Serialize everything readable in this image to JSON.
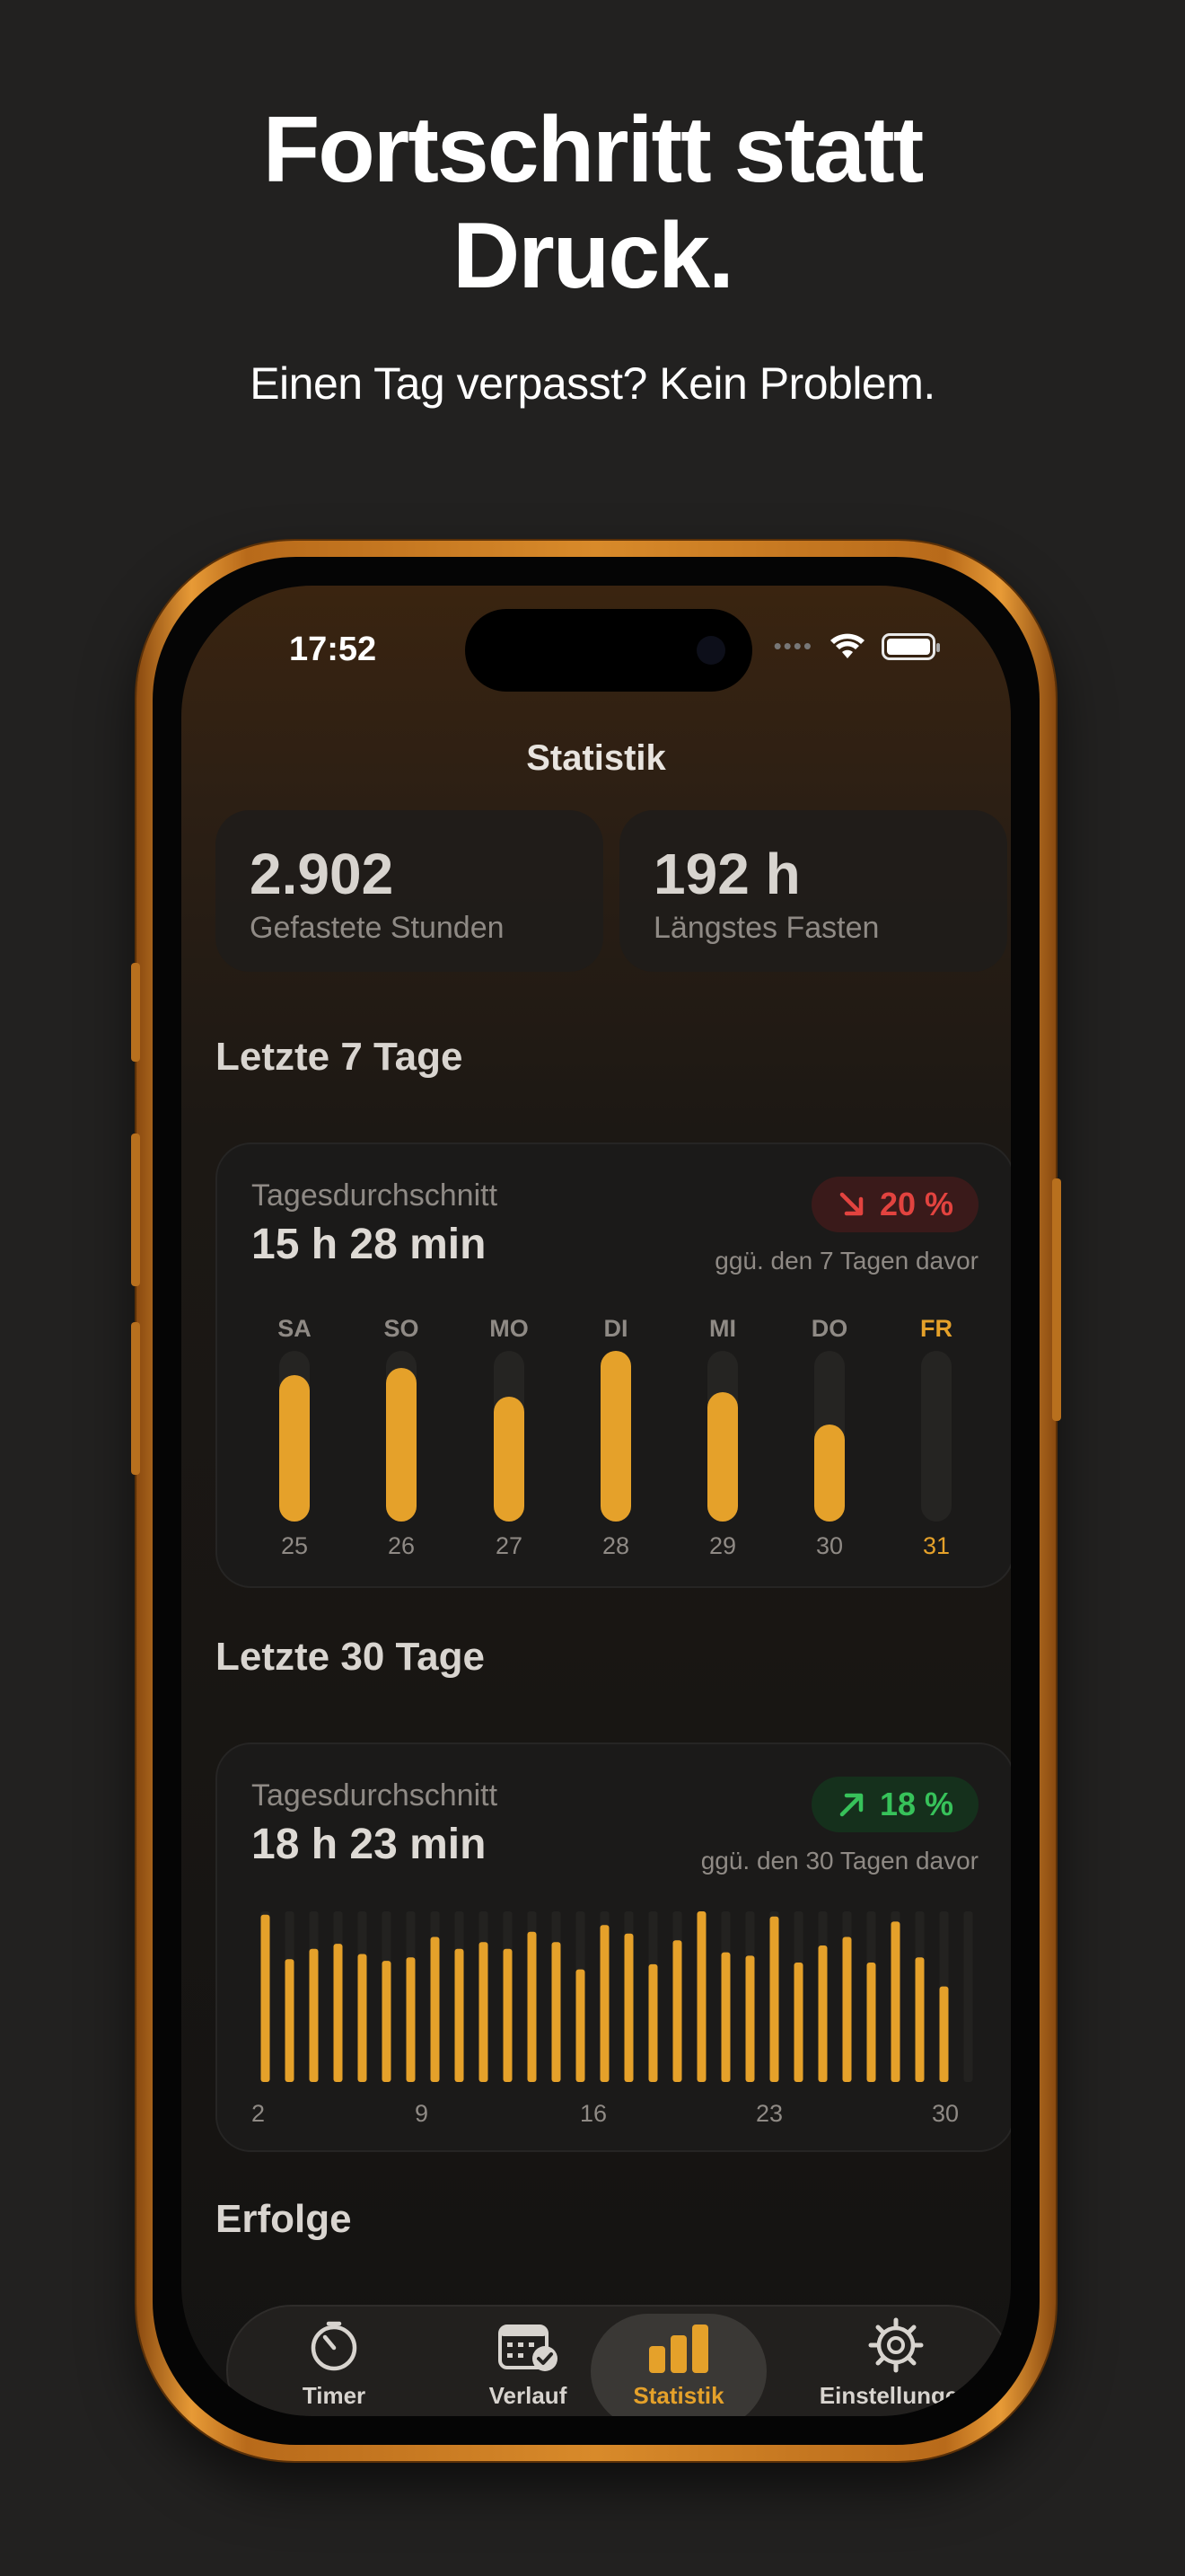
{
  "promo": {
    "headline_line1": "Fortschritt statt",
    "headline_line2": "Druck.",
    "subline": "Einen Tag verpasst? Kein Problem."
  },
  "status_bar": {
    "time": "17:52",
    "icons": [
      "cellular-icon",
      "wifi-icon",
      "battery-icon"
    ]
  },
  "nav": {
    "title": "Statistik"
  },
  "stats": [
    {
      "value": "2.902",
      "label": "Gefastete Stunden"
    },
    {
      "value": "192 h",
      "label": "Längstes Fasten"
    }
  ],
  "last7": {
    "section_title": "Letzte 7 Tage",
    "label": "Tagesdurchschnitt",
    "value": "15 h 28 min",
    "trend": {
      "direction": "down",
      "text": "20 %",
      "color": "#e2433f"
    },
    "compare": "ggü. den 7 Tagen davor",
    "days": [
      {
        "name": "SA",
        "date": "25",
        "fill": 0.86,
        "today": false
      },
      {
        "name": "SO",
        "date": "26",
        "fill": 0.9,
        "today": false
      },
      {
        "name": "MO",
        "date": "27",
        "fill": 0.73,
        "today": false
      },
      {
        "name": "DI",
        "date": "28",
        "fill": 1.0,
        "today": false
      },
      {
        "name": "MI",
        "date": "29",
        "fill": 0.76,
        "today": false
      },
      {
        "name": "DO",
        "date": "30",
        "fill": 0.57,
        "today": false
      },
      {
        "name": "FR",
        "date": "31",
        "fill": 0.0,
        "today": true
      }
    ]
  },
  "last30": {
    "section_title": "Letzte 30 Tage",
    "label": "Tagesdurchschnitt",
    "value": "18 h 23 min",
    "trend": {
      "direction": "up",
      "text": "18 %",
      "color": "#37c25a"
    },
    "compare": "ggü. den 30 Tagen davor",
    "axis_labels": [
      "2",
      "9",
      "16",
      "23",
      "30"
    ],
    "bars": [
      0.98,
      0.72,
      0.78,
      0.81,
      0.75,
      0.71,
      0.73,
      0.85,
      0.78,
      0.82,
      0.78,
      0.88,
      0.82,
      0.66,
      0.92,
      0.87,
      0.69,
      0.83,
      1.0,
      0.76,
      0.74,
      0.97,
      0.7,
      0.8,
      0.85,
      0.7,
      0.94,
      0.73,
      0.56,
      0.0
    ]
  },
  "achievements": {
    "section_title": "Erfolge"
  },
  "tabbar": {
    "items": [
      {
        "label": "Timer",
        "icon": "timer-icon",
        "active": false
      },
      {
        "label": "Verlauf",
        "icon": "calendar-check-icon",
        "active": false
      },
      {
        "label": "Statistik",
        "icon": "bar-chart-icon",
        "active": true
      },
      {
        "label": "Einstellungen",
        "icon": "gear-icon",
        "active": false
      }
    ]
  },
  "colors": {
    "accent": "#e5a12a",
    "phone_frame": "#d88a2a",
    "background": "#222120"
  }
}
